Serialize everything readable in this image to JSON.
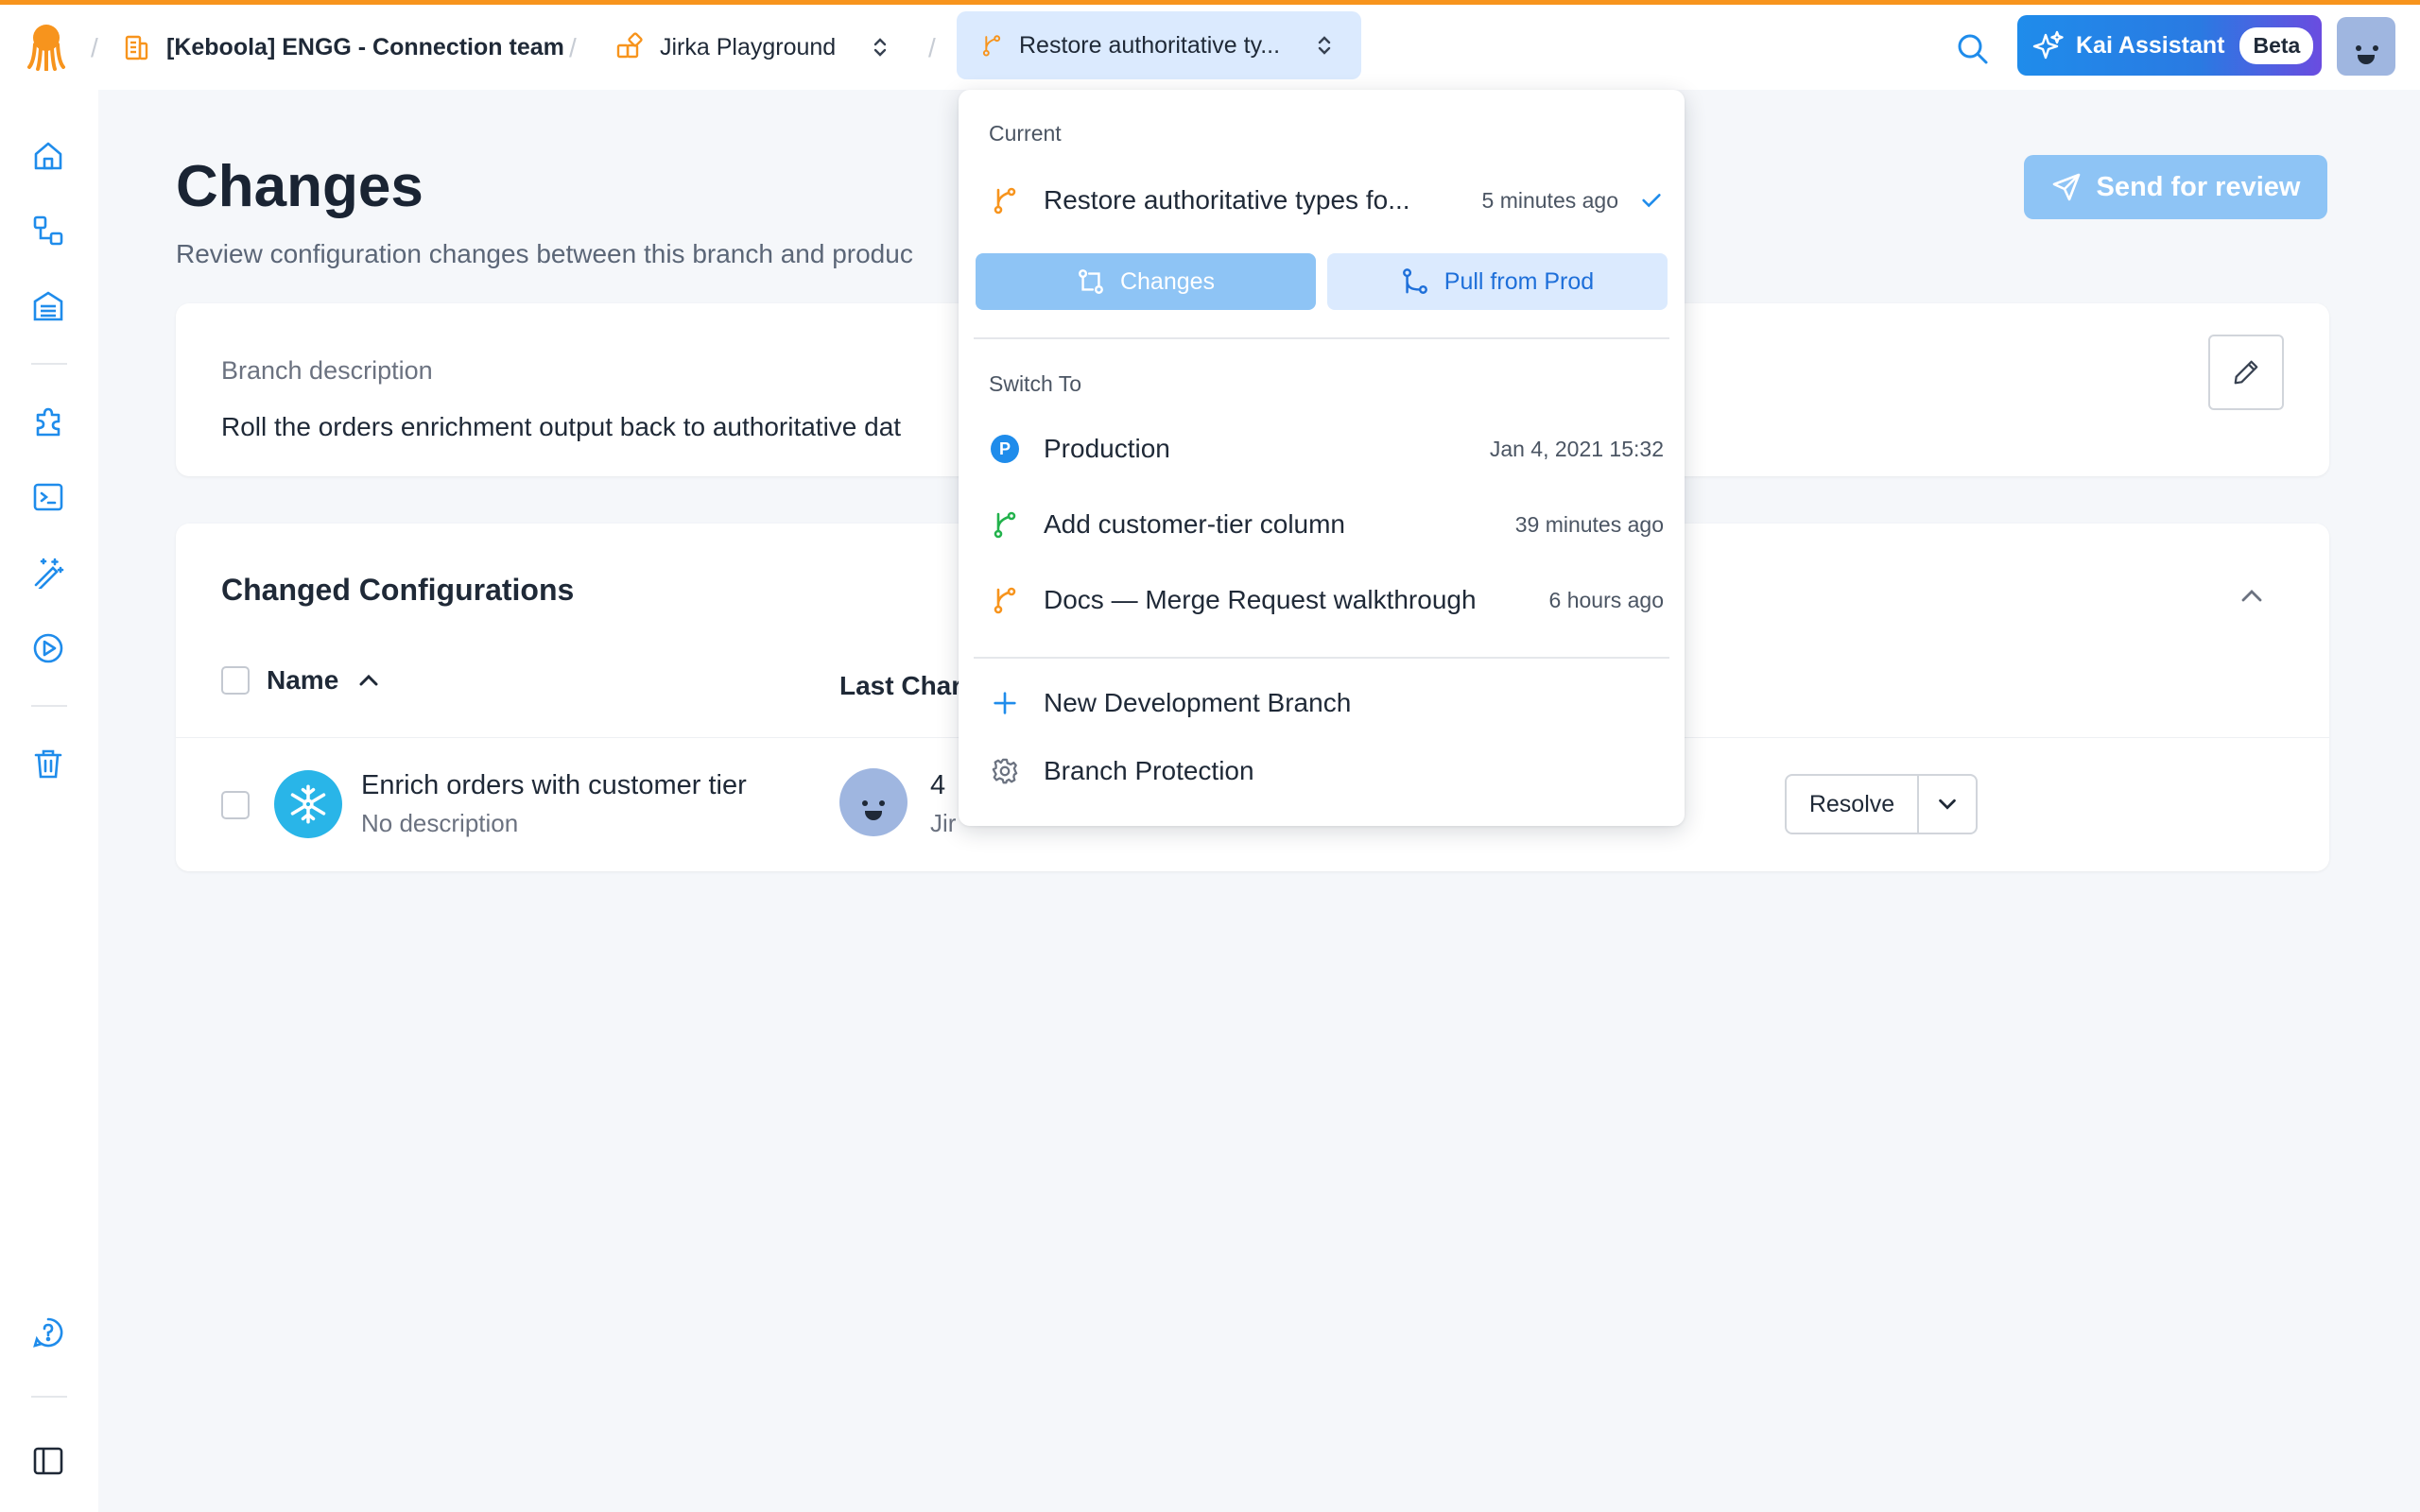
{
  "colors": {
    "accent": "#f7941d",
    "primary": "#1f8ceb",
    "primary_light": "#8ec4f5",
    "branch_orange": "#f7941d",
    "branch_green": "#22b24c"
  },
  "header": {
    "organization": "[Keboola] ENGG - Connection team",
    "project": "Jirka Playground",
    "branch": "Restore authoritative ty...",
    "kai_label": "Kai Assistant",
    "kai_badge": "Beta"
  },
  "page": {
    "title": "Changes",
    "subtitle": "Review configuration changes between this branch and produc",
    "send_button": "Send for review"
  },
  "description_card": {
    "label": "Branch description",
    "text": "Roll the orders enrichment output back to authoritative dat"
  },
  "configurations": {
    "title": "Changed Configurations",
    "columns": {
      "name": "Name",
      "last_change": "Last Char"
    },
    "rows": [
      {
        "name": "Enrich orders with customer tier",
        "description": "No description",
        "change_line1": "4",
        "change_line2": "Jir",
        "action": "Resolve"
      }
    ]
  },
  "branch_menu": {
    "current_heading": "Current",
    "current": {
      "name": "Restore authoritative types fo...",
      "time": "5 minutes ago"
    },
    "changes_button": "Changes",
    "pull_button": "Pull from Prod",
    "switch_heading": "Switch To",
    "branches": [
      {
        "name": "Production",
        "time": "Jan 4, 2021 15:32",
        "icon": "production-badge-icon",
        "badge": "P"
      },
      {
        "name": "Add customer-tier column",
        "time": "39 minutes ago",
        "icon": "branch-icon-green"
      },
      {
        "name": "Docs — Merge Request walkthrough",
        "time": "6 hours ago",
        "icon": "branch-icon-orange"
      }
    ],
    "new_branch": "New Development Branch",
    "protection": "Branch Protection"
  }
}
